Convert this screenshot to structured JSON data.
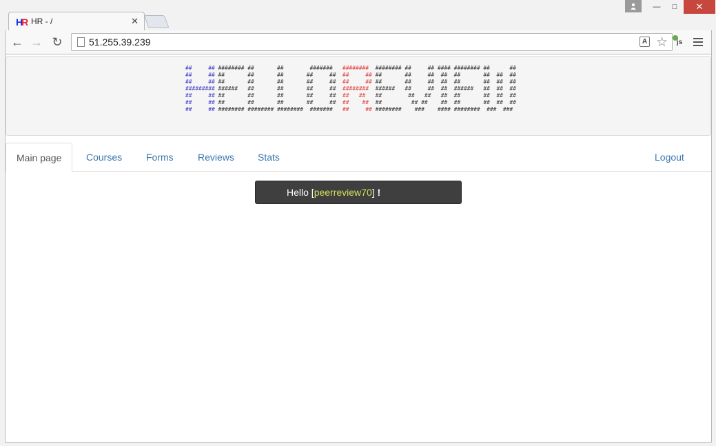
{
  "browser": {
    "tab_title": "HR - /",
    "tab_favicon_h": "H",
    "tab_favicon_r": "R",
    "url": "51.255.39.239",
    "extension_label": "js"
  },
  "banner": {
    "lines": [
      [
        "##     ##",
        " ######## ##       ##        #######   ",
        "########",
        "  ######## ##     ## #### ######## ##      ##"
      ],
      [
        "##     ##",
        " ##       ##       ##       ##     ##  ",
        "##     ##",
        " ##       ##     ##  ##  ##       ##  ##  ##"
      ],
      [
        "##     ##",
        " ##       ##       ##       ##     ##  ",
        "##     ##",
        " ##       ##     ##  ##  ##       ##  ##  ##"
      ],
      [
        "#########",
        " ######   ##       ##       ##     ##  ",
        "########",
        "  ######   ##     ##  ##  ######   ##  ##  ##"
      ],
      [
        "##     ##",
        " ##       ##       ##       ##     ##  ",
        "##   ##",
        "   ##        ##   ##   ##  ##       ##  ##  ##"
      ],
      [
        "##     ##",
        " ##       ##       ##       ##     ##  ",
        "##    ##",
        "  ##         ## ##    ##  ##       ##  ##  ##"
      ],
      [
        "##     ##",
        " ######## ######## ########  #######   ",
        "##     ##",
        " ########    ###    #### ########  ###  ###"
      ]
    ]
  },
  "nav": {
    "main": "Main page",
    "courses": "Courses",
    "forms": "Forms",
    "reviews": "Reviews",
    "stats": "Stats",
    "logout": "Logout"
  },
  "greeting": {
    "prefix": "Hello [",
    "username": "peerreview70",
    "suffix": "]",
    "bang": " !"
  }
}
